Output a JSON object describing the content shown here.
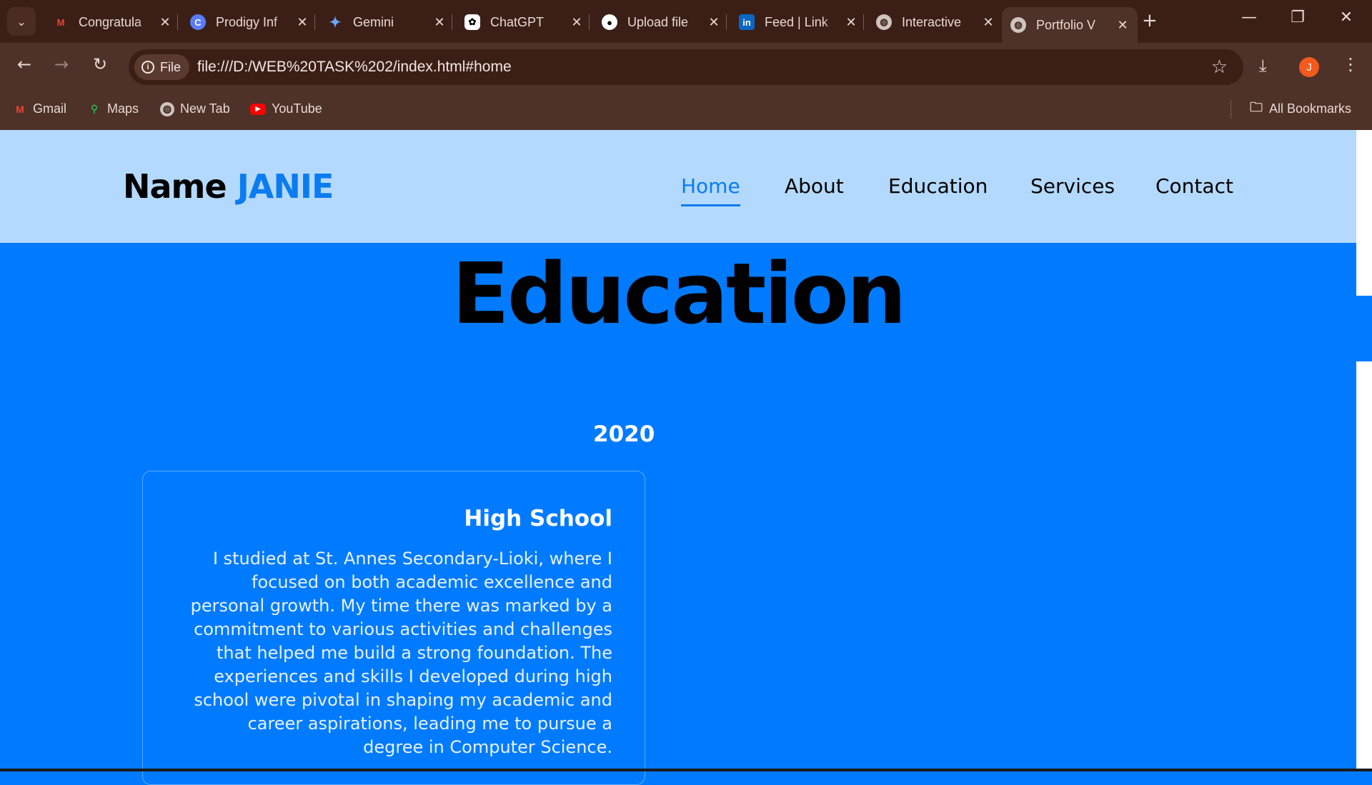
{
  "browser": {
    "tabs": [
      {
        "title": "Congratula",
        "icon": "gmail-icon"
      },
      {
        "title": "Prodigy Inf",
        "icon": "prodigy-icon"
      },
      {
        "title": "Gemini",
        "icon": "gemini-icon"
      },
      {
        "title": "ChatGPT",
        "icon": "chatgpt-icon"
      },
      {
        "title": "Upload file",
        "icon": "github-icon"
      },
      {
        "title": "Feed | Link",
        "icon": "linkedin-icon"
      },
      {
        "title": "Interactive",
        "icon": "globe-icon"
      },
      {
        "title": "Portfolio V",
        "icon": "globe-icon",
        "active": true
      }
    ],
    "address": {
      "chip_label": "File",
      "url": "file:///D:/WEB%20TASK%202/index.html#home"
    },
    "profile_initial": "J",
    "bookmarks": [
      "Gmail",
      "Maps",
      "New Tab",
      "YouTube"
    ],
    "all_bookmarks": "All Bookmarks"
  },
  "site": {
    "logo_prefix": "Name",
    "logo_name": "JANIE",
    "nav": [
      "Home",
      "About",
      "Education",
      "Services",
      "Contact"
    ],
    "active_nav": "Home"
  },
  "education": {
    "title": "Education",
    "entries": [
      {
        "year": "2020",
        "heading": "High School",
        "text": "I studied at St. Annes Secondary-Lioki, where I focused on both academic excellence and personal growth. My time there was marked by a commitment to various activities and challenges that helped me build a strong foundation. The experiences and skills I developed during high school were pivotal in shaping my academic and career aspirations, leading me to pursue a degree in Computer Science."
      }
    ]
  },
  "colors": {
    "accent": "#0a7cf0",
    "page_bg": "#007bff",
    "header_bg": "#b4d9ff",
    "browser_frame": "#4e3128"
  }
}
